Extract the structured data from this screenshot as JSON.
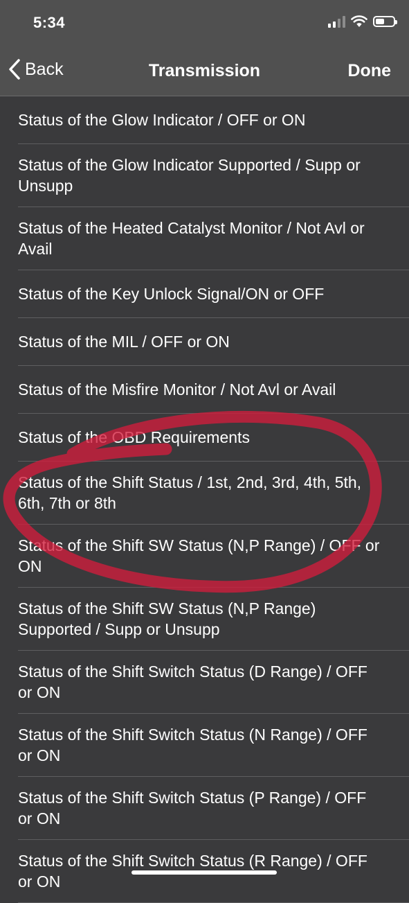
{
  "status_bar": {
    "time": "5:34"
  },
  "nav": {
    "back_label": "Back",
    "title": "Transmission",
    "done_label": "Done"
  },
  "items": [
    "Status of the Glow Indicator / OFF or ON",
    "Status of the Glow Indicator Supported / Supp or Unsupp",
    "Status of the Heated Catalyst Monitor / Not Avl or Avail",
    "Status of the Key Unlock Signal/ON or OFF",
    "Status of the MIL / OFF or ON",
    "Status of the Misfire Monitor / Not Avl or Avail",
    "Status of the OBD Requirements",
    "Status of the Shift Status / 1st, 2nd, 3rd, 4th, 5th, 6th, 7th or 8th",
    "Status of the Shift SW Status (N,P Range) / OFF or ON",
    "Status of the Shift SW Status (N,P Range) Supported / Supp or Unsupp",
    "Status of the Shift Switch Status (D Range) / OFF or ON",
    "Status of the Shift Switch Status (N Range) / OFF or ON",
    "Status of the Shift Switch Status (P Range) / OFF or ON",
    "Status of the Shift Switch Status (R Range) / OFF or ON"
  ],
  "colors": {
    "background": "#3a3a3c",
    "bar": "#505050",
    "annotation": "#d21e3c"
  }
}
